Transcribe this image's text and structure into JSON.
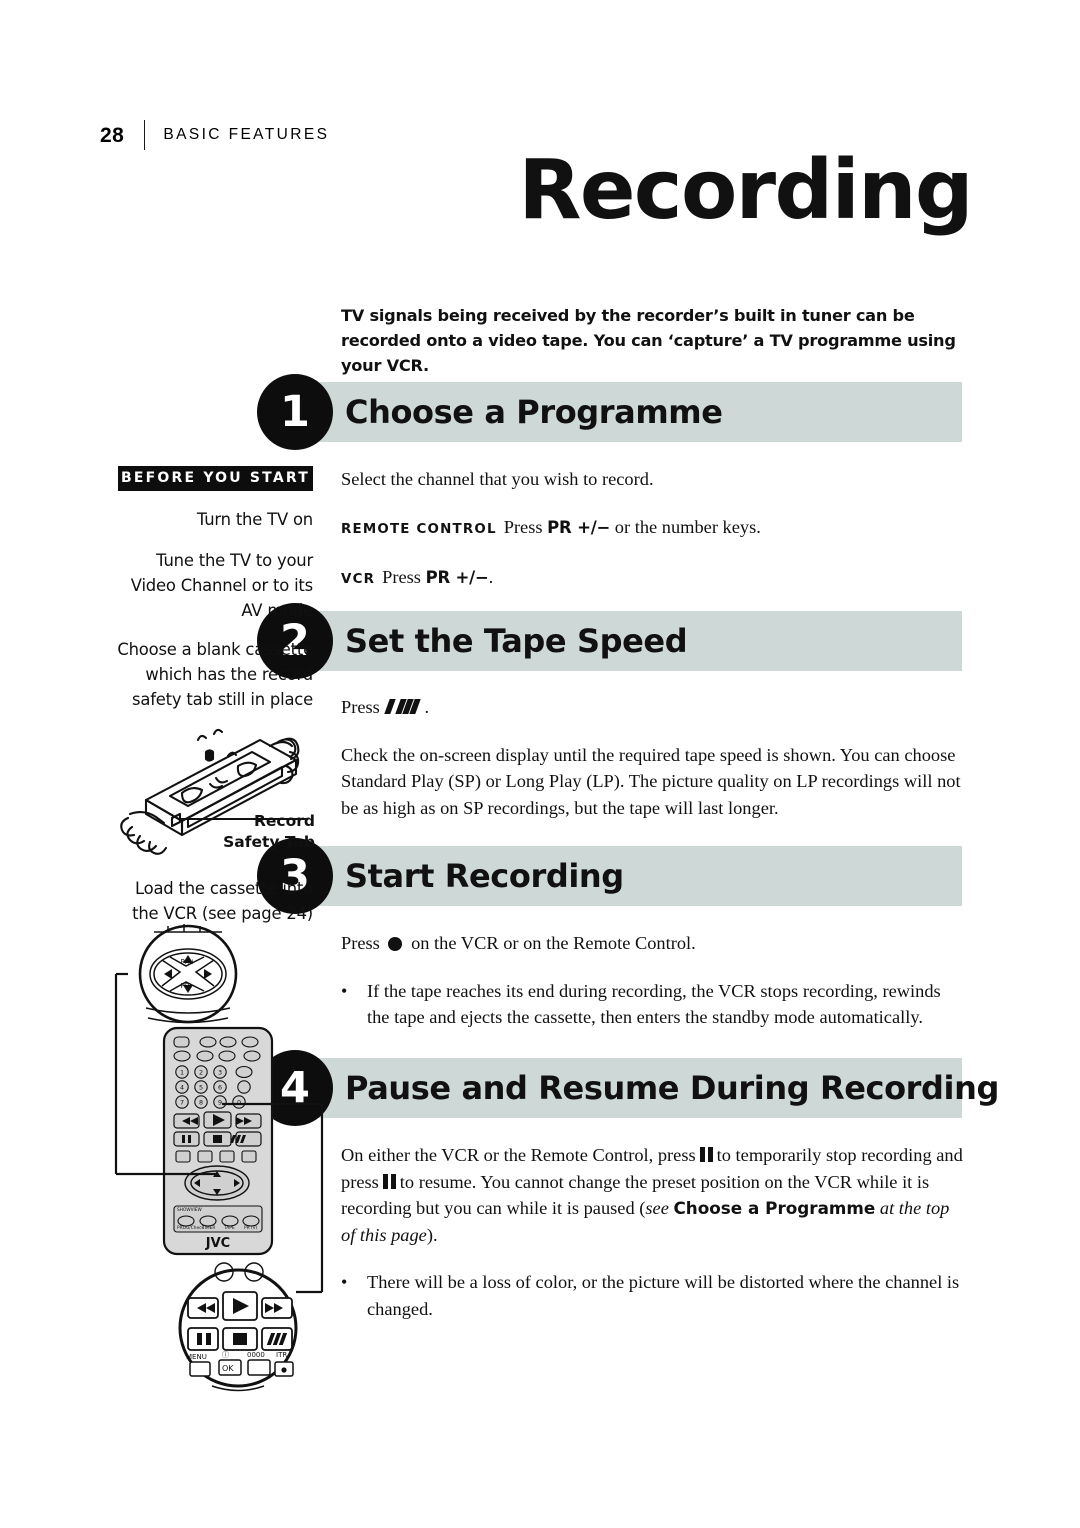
{
  "runhead": {
    "page_number": "28",
    "section": "BASIC FEATURES"
  },
  "title": "Recording",
  "intro": "TV signals being received by the recorder’s built in tuner can be recorded onto a video tape. You can ‘capture’ a TV programme using your VCR.",
  "steps": [
    {
      "number": "1",
      "title": "Choose a Programme",
      "lead": "Select the channel that you wish to record.",
      "remote_label": "REMOTE CONTROL",
      "remote_text_pre": "Press",
      "remote_key": "PR +/−",
      "remote_text_post": "or the number keys.",
      "vcr_label": "VCR",
      "vcr_text_pre": "Press",
      "vcr_key": "PR +/−",
      "vcr_text_post": "."
    },
    {
      "number": "2",
      "title": "Set the Tape Speed",
      "press_pre": "Press",
      "press_post": ".",
      "body": "Check the on-screen display until the required tape speed is shown. You can choose Standard Play (SP) or Long Play (LP). The picture quality on LP recordings will not be as high as on SP recordings, but the tape will last longer."
    },
    {
      "number": "3",
      "title": "Start Recording",
      "press_pre": "Press",
      "press_post": "on the VCR or on the Remote Control.",
      "bullet": "If the tape reaches its end during recording, the VCR stops recording, rewinds the tape and ejects the cassette, then enters the standby mode automatically.",
      "bullet_dot": "•"
    },
    {
      "number": "4",
      "title": "Pause and Resume During Recording",
      "para_a": "On either the VCR or the Remote Control, press",
      "para_b": "to temporarily stop recording and press",
      "para_c": "to resume. You cannot change the preset position on the VCR while it is recording but you can while it is paused (",
      "xref_see": "see",
      "xref_bold": "Choose a Programme",
      "xref_tail": "at the top of this page",
      "para_d": ").",
      "bullet": "There will be a loss of color, or the picture will be distorted where the channel is changed.",
      "bullet_dot": "•"
    }
  ],
  "sidebar": {
    "badge": "BEFORE YOU START",
    "notes": [
      "Turn the TV on",
      "Tune the TV to your Video Channel or to its AV mode",
      "Choose a blank cassette which has the record safety tab still in place",
      "Load the cassette into the VCR (see page 24)"
    ],
    "tab_caption_line1": "Record",
    "tab_caption_line2": "Safety Tab",
    "remote_brand": "JVC"
  },
  "colors": {
    "step_bar": "#ced8d6",
    "badge_fill": "#0d0d0d",
    "text": "#111111",
    "remote_body": "#d8d8d8"
  }
}
